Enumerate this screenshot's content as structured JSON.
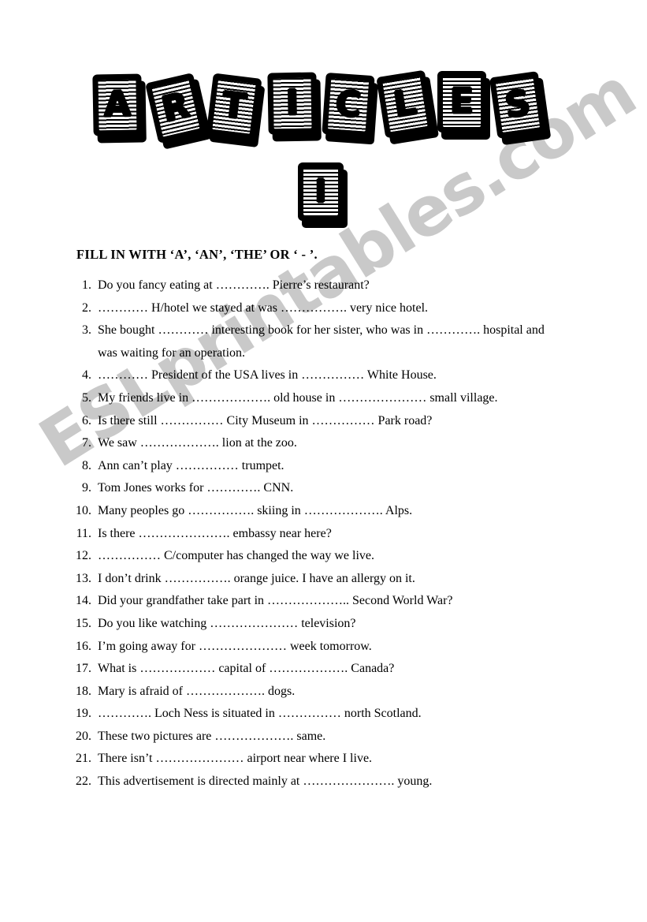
{
  "document": {
    "title_letters": [
      "A",
      "R",
      "T",
      "I",
      "C",
      "L",
      "E",
      "S"
    ],
    "subtitle_letter": "I",
    "instruction": "FILL IN WITH ‘A’, ‘AN’, ‘THE’  OR  ‘ - ’.",
    "watermark": "ESLprintables.com",
    "watermark_color": "#c9c9c9",
    "ink_color": "#000000",
    "page_color": "#ffffff"
  },
  "exercises": [
    {
      "number": "1.",
      "text": "Do you fancy eating at …………. Pierre’s restaurant?"
    },
    {
      "number": "2.",
      "text": "………… H/hotel we stayed at was ……………. very nice hotel."
    },
    {
      "number": "3.",
      "text": "She bought ………… interesting book for her sister, who was in …………. hospital and",
      "continuation": "was waiting for an operation."
    },
    {
      "number": "4.",
      "text": "………… President of the USA lives in …………… White House."
    },
    {
      "number": "5.",
      "text": "My friends live in ………………. old house in ………………… small village."
    },
    {
      "number": "6.",
      "text": "Is there still …………… City Museum in …………… Park road?"
    },
    {
      "number": "7.",
      "text": "We saw ………………. lion at the zoo."
    },
    {
      "number": "8.",
      "text": "Ann can’t play …………… trumpet."
    },
    {
      "number": "9.",
      "text": "Tom Jones works for …………. CNN."
    },
    {
      "number": "10.",
      "text": "Many peoples go ……………. skiing in ………………. Alps."
    },
    {
      "number": "11.",
      "text": "Is there …………………. embassy near here?"
    },
    {
      "number": "12.",
      "text": "…………… C/computer has changed the way we live."
    },
    {
      "number": "13.",
      "text": "I don’t drink ……………. orange juice. I have an allergy on it."
    },
    {
      "number": "14.",
      "text": "Did your grandfather take part in ……………….. Second World War?"
    },
    {
      "number": "15.",
      "text": "Do you like watching ………………… television?"
    },
    {
      "number": "16.",
      "text": "I’m going away for ………………… week tomorrow."
    },
    {
      "number": "17.",
      "text": "What is ……………… capital of ………………. Canada?"
    },
    {
      "number": "18.",
      "text": "Mary is afraid of ………………. dogs."
    },
    {
      "number": "19.",
      "text": "…………. Loch Ness is situated in …………… north Scotland."
    },
    {
      "number": "20.",
      "text": "These two pictures are ………………. same."
    },
    {
      "number": "21.",
      "text": "There isn’t ………………… airport near where I live."
    },
    {
      "number": "22.",
      "text": "This advertisement is directed mainly at …………………. young."
    }
  ]
}
